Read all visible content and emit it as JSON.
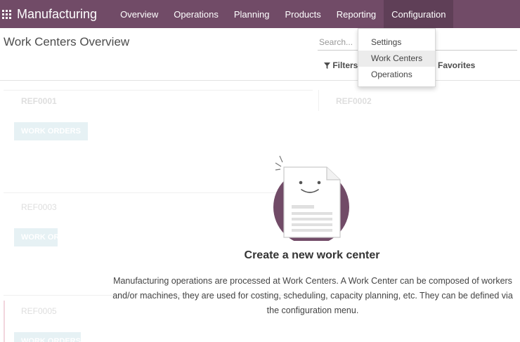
{
  "navbar": {
    "brand": "Manufacturing",
    "menu": [
      {
        "label": "Overview"
      },
      {
        "label": "Operations"
      },
      {
        "label": "Planning"
      },
      {
        "label": "Products"
      },
      {
        "label": "Reporting"
      },
      {
        "label": "Configuration"
      }
    ],
    "active_menu": "Configuration"
  },
  "control_panel": {
    "title": "Work Centers Overview",
    "search_placeholder": "Search...",
    "filters_label": "Filters",
    "favorites_label": "Favorites"
  },
  "dropdown": {
    "items": [
      {
        "label": "Settings"
      },
      {
        "label": "Work Centers"
      },
      {
        "label": "Operations"
      }
    ],
    "highlighted": "Work Centers"
  },
  "background_cards": [
    {
      "ref": "REF0001",
      "button": "WORK ORDERS"
    },
    {
      "ref": "REF0002"
    },
    {
      "ref": "REF0003",
      "button": "WORK ORDERS"
    },
    {
      "ref": "REF0005",
      "button": "WORK ORDERS"
    }
  ],
  "help": {
    "title": "Create a new work center",
    "text": "Manufacturing operations are processed at Work Centers. A Work Center can be composed of workers and/or machines, they are used for costing, scheduling, capacity planning, etc. They can be defined via the configuration menu."
  },
  "colors": {
    "navbar": "#714b67",
    "illustration_circle": "#714b67"
  }
}
